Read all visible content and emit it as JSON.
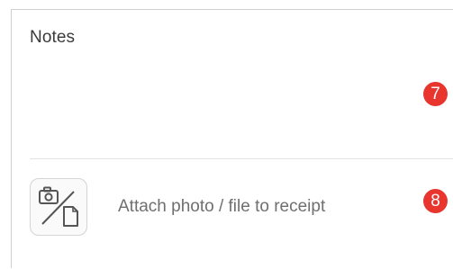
{
  "notes": {
    "label": "Notes"
  },
  "attachment": {
    "label": "Attach photo / file to receipt",
    "icon": "camera-file-icon"
  },
  "markers": {
    "notes_marker": "7",
    "attach_marker": "8"
  },
  "colors": {
    "marker": "#e8352e",
    "label_text": "#3a3a3a",
    "attach_text": "#6f6f6f",
    "divider": "#e3e3e3"
  }
}
